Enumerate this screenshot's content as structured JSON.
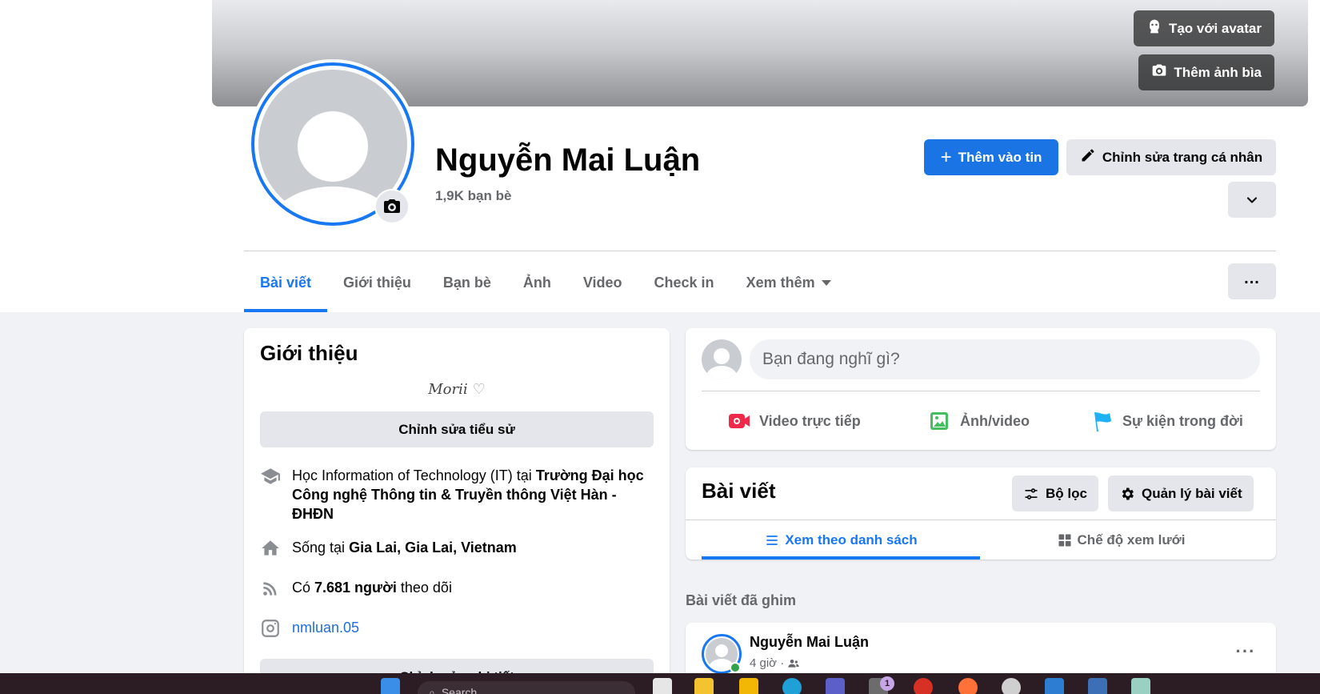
{
  "cover": {
    "avatar_button_label": "Tạo với avatar",
    "cover_photo_button_label": "Thêm ảnh bìa"
  },
  "profile": {
    "name": "Nguyễn Mai Luận",
    "friends": "1,9K bạn bè",
    "add_story_label": "Thêm vào tin",
    "edit_profile_label": "Chỉnh sửa trang cá nhân"
  },
  "tabs": [
    "Bài viết",
    "Giới thiệu",
    "Bạn bè",
    "Ảnh",
    "Video",
    "Check in",
    "Xem thêm"
  ],
  "intro": {
    "title": "Giới thiệu",
    "bio": "Morii",
    "edit_bio_label": "Chỉnh sửa tiểu sử",
    "study_prefix": "Học Information of Technology (IT) tại ",
    "study_school": "Trường Đại học Công nghệ Thông tin & Truyền thông Việt Hàn - ĐHĐN",
    "live_prefix": "Sống tại ",
    "live_place": "Gia Lai, Gia Lai, Vietnam",
    "followers_prefix": "Có ",
    "followers_count": "7.681 người",
    "followers_suffix": " theo dõi",
    "instagram": "nmluan.05",
    "edit_details_label": "Chỉnh sửa chi tiết"
  },
  "composer": {
    "placeholder": "Bạn đang nghĩ gì?",
    "live_video": "Video trực tiếp",
    "photo_video": "Ảnh/video",
    "life_event": "Sự kiện trong đời"
  },
  "posts": {
    "title": "Bài viết",
    "filter_label": "Bộ lọc",
    "manage_label": "Quản lý bài viết",
    "list_view": "Xem theo danh sách",
    "grid_view": "Chế độ xem lưới",
    "pinned_label": "Bài viết đã ghim",
    "post_author": "Nguyễn Mai Luận",
    "post_time": "4 giờ ·"
  },
  "taskbar": {
    "search_placeholder": "Search",
    "badge_count": "1"
  },
  "colors": {
    "accent": "#1877f2",
    "background": "#f0f2f5",
    "taskbar": "#2b1d23"
  }
}
